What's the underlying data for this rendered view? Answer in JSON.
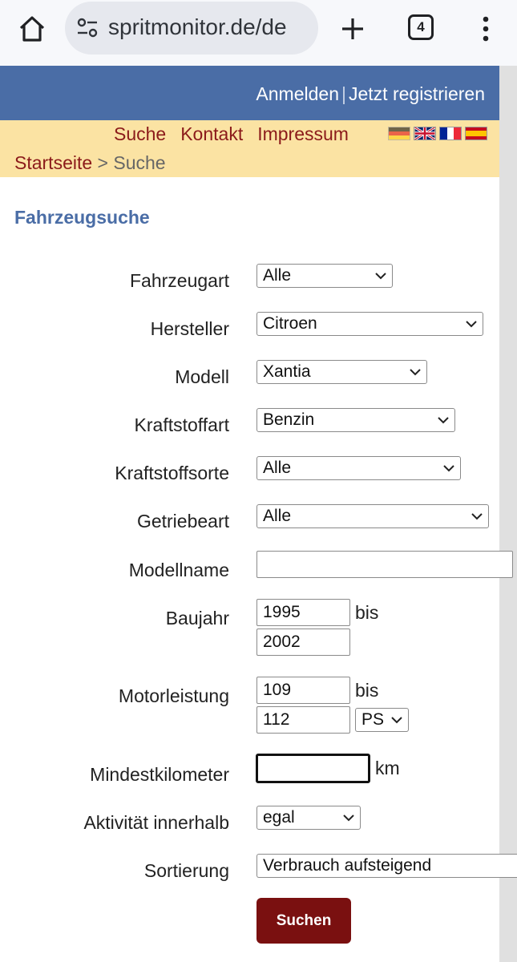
{
  "browser": {
    "url": "spritmonitor.de/de",
    "tab_count": "4",
    "icons": [
      "home-icon",
      "site-settings-icon",
      "new-tab-icon",
      "tab-switcher-icon",
      "more-menu-icon"
    ]
  },
  "header": {
    "login": "Anmelden",
    "separator": "|",
    "register": "Jetzt registrieren"
  },
  "nav": {
    "items": [
      "Suche",
      "Kontakt",
      "Impressum"
    ],
    "languages": [
      "de",
      "en",
      "fr",
      "es"
    ],
    "breadcrumb_home": "Startseite",
    "breadcrumb_rest": "> Suche"
  },
  "page": {
    "heading": "Fahrzeugsuche"
  },
  "form": {
    "fahrzeugart": {
      "label": "Fahrzeugart",
      "value": "Alle"
    },
    "hersteller": {
      "label": "Hersteller",
      "value": "Citroen"
    },
    "modell": {
      "label": "Modell",
      "value": "Xantia"
    },
    "kraftstoffart": {
      "label": "Kraftstoffart",
      "value": "Benzin"
    },
    "kraftstoffsorte": {
      "label": "Kraftstoffsorte",
      "value": "Alle"
    },
    "getriebeart": {
      "label": "Getriebeart",
      "value": "Alle"
    },
    "modellname": {
      "label": "Modellname",
      "value": ""
    },
    "baujahr": {
      "label": "Baujahr",
      "from": "1995",
      "to": "2002",
      "bis": "bis"
    },
    "motorleistung": {
      "label": "Motorleistung",
      "from": "109",
      "to": "112",
      "bis": "bis",
      "unit": "PS"
    },
    "mindestkilometer": {
      "label": "Mindestkilometer",
      "value": "",
      "unit": "km"
    },
    "aktivitaet": {
      "label": "Aktivität innerhalb",
      "value": "egal"
    },
    "sortierung": {
      "label": "Sortierung",
      "value": "Verbrauch aufsteigend"
    },
    "submit": "Suchen"
  },
  "colors": {
    "header_blue": "#4a6da6",
    "nav_yellow": "#fbe3a3",
    "link_red": "#8b1a1a",
    "button_red": "#7a1010"
  }
}
